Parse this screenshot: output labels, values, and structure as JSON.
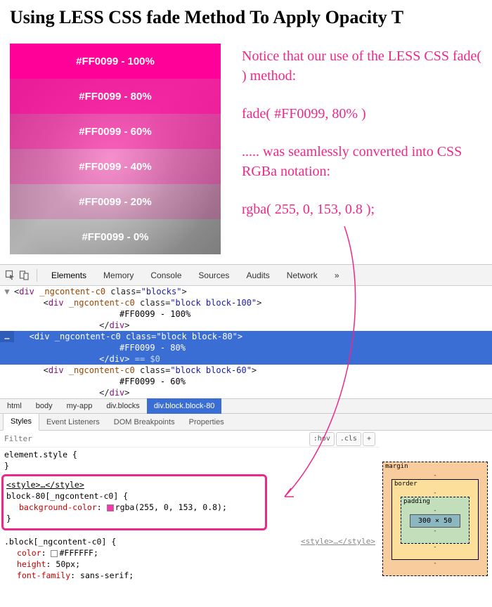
{
  "title": "Using LESS CSS fade Method To Apply Opacity T",
  "blocks": [
    {
      "label": "#FF0099 - 100%",
      "cls": "block-100"
    },
    {
      "label": "#FF0099 - 80%",
      "cls": "block-80"
    },
    {
      "label": "#FF0099 - 60%",
      "cls": "block-60"
    },
    {
      "label": "#FF0099 - 40%",
      "cls": "block-40"
    },
    {
      "label": "#FF0099 - 20%",
      "cls": "block-20"
    },
    {
      "label": "#FF0099 - 0%",
      "cls": "block-0"
    }
  ],
  "annot": {
    "l1": "Notice that our use of the LESS CSS fade( ) method:",
    "l2": "fade( #FF0099, 80% )",
    "l3": "..... was seamlessly converted into CSS RGBa notation:",
    "l4": "rgba( 255, 0, 153, 0.8 );"
  },
  "devtools": {
    "tabs": [
      "Elements",
      "Memory",
      "Console",
      "Sources",
      "Audits",
      "Network"
    ],
    "more": "»",
    "dom": {
      "l0a": "<div ",
      "l0b": "_ngcontent-c0",
      "l0c": " class=",
      "l0d": "\"blocks\"",
      "l0e": ">",
      "l1a": "<div ",
      "l1b": "_ngcontent-c0",
      "l1c": " class=",
      "l1d": "\"block block-100\"",
      "l1e": ">",
      "l2": "#FF0099 - 100%",
      "l3": "</div>",
      "l4a": "<div ",
      "l4b": "_ngcontent-c0",
      "l4c": " class=",
      "l4d": "\"block block-80\"",
      "l4e": ">",
      "l5": "#FF0099 - 80%",
      "l6a": "</div>",
      "l6b": " == $0",
      "l7a": "<div ",
      "l7b": "_ngcontent-c0",
      "l7c": " class=",
      "l7d": "\"block block-60\"",
      "l7e": ">",
      "l8": "#FF0099 - 60%",
      "l9": "</div>",
      "ell": "…"
    },
    "crumbs": [
      "html",
      "body",
      "my-app",
      "div.blocks",
      "div.block.block-80"
    ],
    "subtabs": [
      "Styles",
      "Event Listeners",
      "DOM Breakpoints",
      "Properties"
    ],
    "filter_placeholder": "Filter",
    "hov": ":hov",
    "cls": ".cls",
    "plus": "+",
    "rules": {
      "r0_sel": "element.style {",
      "r0_close": "}",
      "r1_sel": "block-80[_ngcontent-c0] {",
      "r1_prop_k": "background-color",
      "r1_prop_v": "rgba(255, 0, 153, 0.8)",
      "r1_close": "}",
      "r1_src": "<style>…</style>",
      "r2_sel": ".block[_ngcontent-c0] {",
      "r2_src": "<style>…</style>",
      "r2_p1k": "color",
      "r2_p1v": "#FFFFFF",
      "r2_p2k": "height",
      "r2_p2v": "50px",
      "r2_p3k": "font-family",
      "r2_p3v": "sans-serif"
    },
    "boxmodel": {
      "margin": "margin",
      "border": "border",
      "padding": "padding",
      "content": "300 × 50",
      "dash": "-"
    }
  }
}
